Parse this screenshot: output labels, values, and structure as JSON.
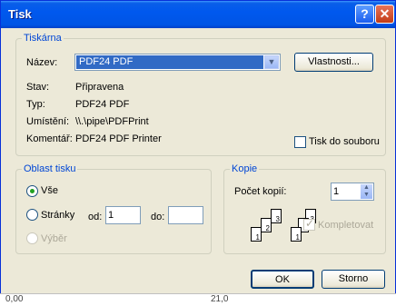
{
  "window": {
    "title": "Tisk",
    "help_glyph": "?",
    "close_glyph": "✕"
  },
  "printer": {
    "legend": "Tiskárna",
    "name_label": "Název:",
    "name_value": "PDF24 PDF",
    "properties_button": "Vlastnosti...",
    "status_label": "Stav:",
    "status_value": "Připravena",
    "type_label": "Typ:",
    "type_value": "PDF24 PDF",
    "where_label": "Umístění:",
    "where_value": "\\\\.\\pipe\\PDFPrint",
    "comment_label": "Komentář:",
    "comment_value": "PDF24 PDF Printer",
    "print_to_file_label": "Tisk do souboru",
    "print_to_file_checked": false
  },
  "print_range": {
    "legend": "Oblast tisku",
    "all_label": "Vše",
    "pages_label": "Stránky",
    "from_label": "od:",
    "from_value": "1",
    "to_label": "do:",
    "to_value": "",
    "selection_label": "Výběr",
    "selected": "all"
  },
  "copies": {
    "legend": "Kopie",
    "count_label": "Počet kopií:",
    "count_value": "1",
    "collate_label": "Kompletovat",
    "collate_checked": true,
    "collate_enabled": false,
    "page_numbers": [
      "1",
      "2",
      "3"
    ]
  },
  "buttons": {
    "ok": "OK",
    "cancel": "Storno"
  },
  "behind": {
    "left_text": "0,00",
    "right_text": "21,0"
  }
}
